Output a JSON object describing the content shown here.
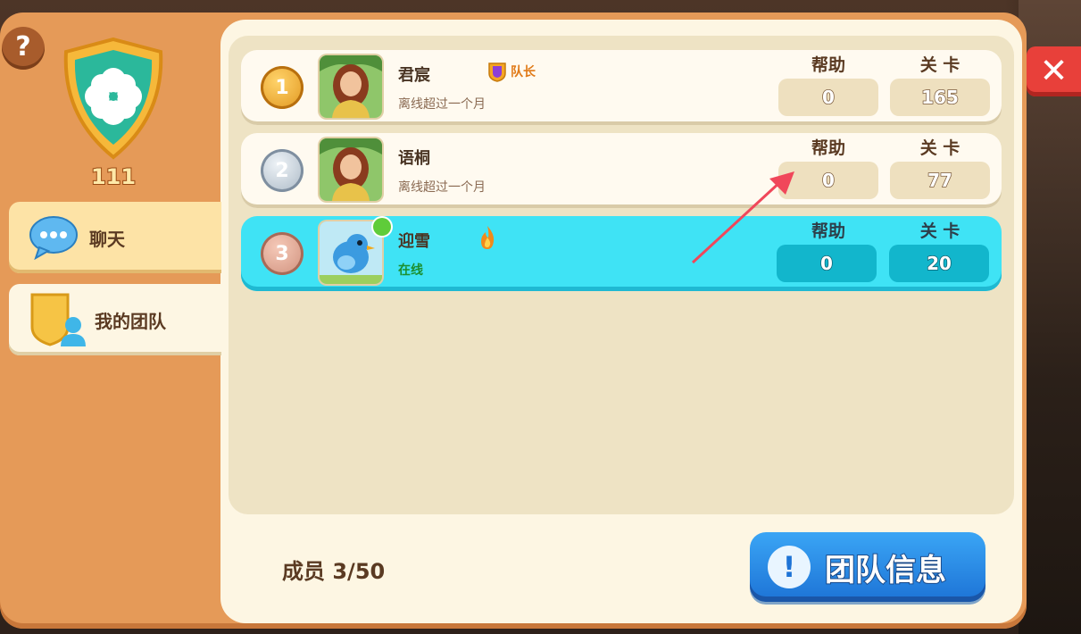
{
  "team": {
    "level": "111",
    "help_icon": "question-mark-icon",
    "close_icon": "close-x-icon"
  },
  "tabs": [
    {
      "label": "聊天",
      "icon": "chat-bubble-icon"
    },
    {
      "label": "我的团队",
      "icon": "team-shield-icon"
    }
  ],
  "columns": {
    "help": "帮助",
    "level": "关 卡"
  },
  "members": [
    {
      "rank": "1",
      "name": "君宸",
      "role": "队长",
      "status": "离线超过一个月",
      "help": "0",
      "level": "165"
    },
    {
      "rank": "2",
      "name": "语桐",
      "status": "离线超过一个月",
      "help": "0",
      "level": "77"
    },
    {
      "rank": "3",
      "name": "迎雪",
      "status": "在线",
      "help": "0",
      "level": "20"
    }
  ],
  "footer": {
    "member_count": "成员 3/50",
    "team_info_label": "团队信息",
    "team_info_icon": "exclamation-icon"
  },
  "colors": {
    "frame": "#e59a58",
    "online_row": "#3fe3f5",
    "button_blue": "#1d73d6",
    "close_red": "#e8403a"
  }
}
